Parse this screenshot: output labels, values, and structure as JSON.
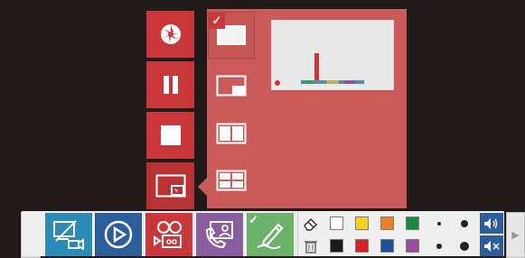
{
  "side_buttons": [
    {
      "name": "camera-aperture-icon"
    },
    {
      "name": "pause-icon"
    },
    {
      "name": "stop-icon"
    },
    {
      "name": "layout-icon"
    }
  ],
  "layout_options": [
    {
      "name": "layout-fullscreen",
      "selected": true
    },
    {
      "name": "layout-picture-in-picture",
      "selected": false
    },
    {
      "name": "layout-side-by-side",
      "selected": false
    },
    {
      "name": "layout-grid",
      "selected": false
    }
  ],
  "toolbar": {
    "tools": [
      {
        "name": "screen-camera-tool",
        "color": "#2b8ab6"
      },
      {
        "name": "play-tool",
        "color": "#2d5d9b"
      },
      {
        "name": "camera-recorder-tool",
        "color": "#c8383a"
      },
      {
        "name": "phone-contact-tool",
        "color": "#8a5da0"
      },
      {
        "name": "pen-tool",
        "color": "#6db26a",
        "checked": true
      }
    ],
    "colors_top": [
      "#ffffff",
      "#f4d21d",
      "#ee7f22",
      "#138a3e"
    ],
    "colors_bottom": [
      "#1a1a1a",
      "#d72127",
      "#1f4fa0",
      "#9b4c9b"
    ],
    "volume": {
      "up_icon": "speaker-on-icon",
      "mute_icon": "speaker-mute-icon"
    }
  }
}
